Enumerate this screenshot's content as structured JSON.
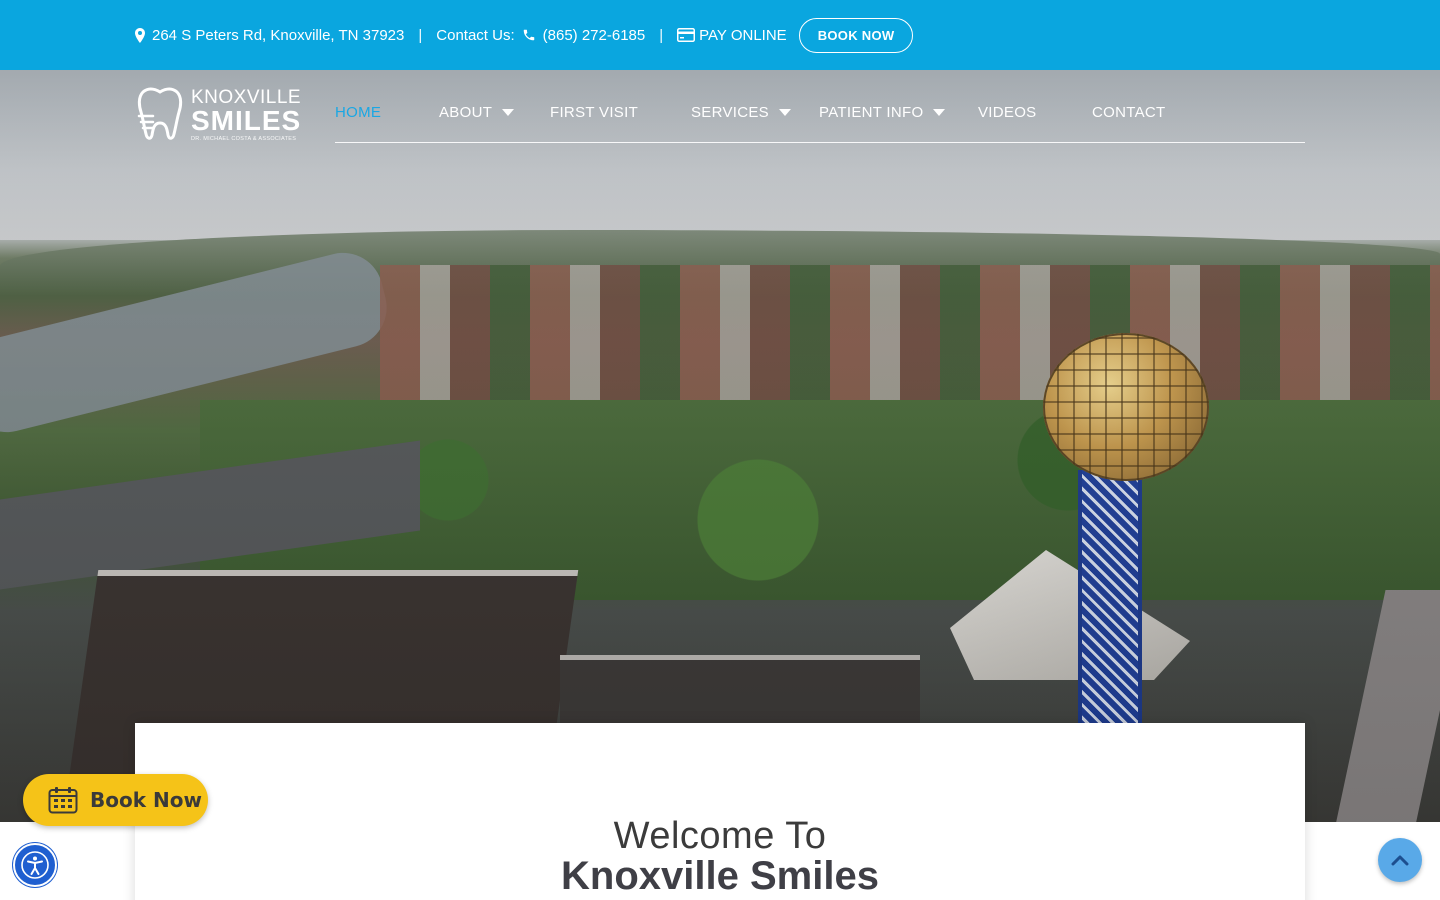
{
  "topbar": {
    "address": "264 S Peters Rd, Knoxville, TN 37923",
    "separator": "|",
    "contact_label": "Contact Us:",
    "phone": "(865) 272-6185",
    "pay_online": "PAY ONLINE",
    "book_now": "BOOK NOW"
  },
  "logo": {
    "line1": "KNOXVILLE",
    "line2": "SMILES",
    "tagline": "DR. MICHAEL COSTA & ASSOCIATES"
  },
  "nav": {
    "items": [
      {
        "label": "HOME",
        "active": true,
        "dropdown": false
      },
      {
        "label": "ABOUT",
        "active": false,
        "dropdown": true
      },
      {
        "label": "FIRST VISIT",
        "active": false,
        "dropdown": false
      },
      {
        "label": "SERVICES",
        "active": false,
        "dropdown": true
      },
      {
        "label": "PATIENT INFO",
        "active": false,
        "dropdown": true
      },
      {
        "label": "VIDEOS",
        "active": false,
        "dropdown": false
      },
      {
        "label": "CONTACT",
        "active": false,
        "dropdown": false
      }
    ]
  },
  "welcome": {
    "line1": "Welcome To",
    "line2": "Knoxville Smiles"
  },
  "floating": {
    "book_now": "Book Now"
  },
  "colors": {
    "topbar": "#0aa6df",
    "active_nav": "#1aa7e4",
    "book_button": "#f5c318",
    "accessibility": "#1f5fd0"
  },
  "icons": [
    "map-marker-icon",
    "phone-icon",
    "credit-card-icon",
    "tooth-logo-icon",
    "caret-down-icon",
    "calendar-icon",
    "accessibility-icon",
    "chevron-up-icon"
  ]
}
